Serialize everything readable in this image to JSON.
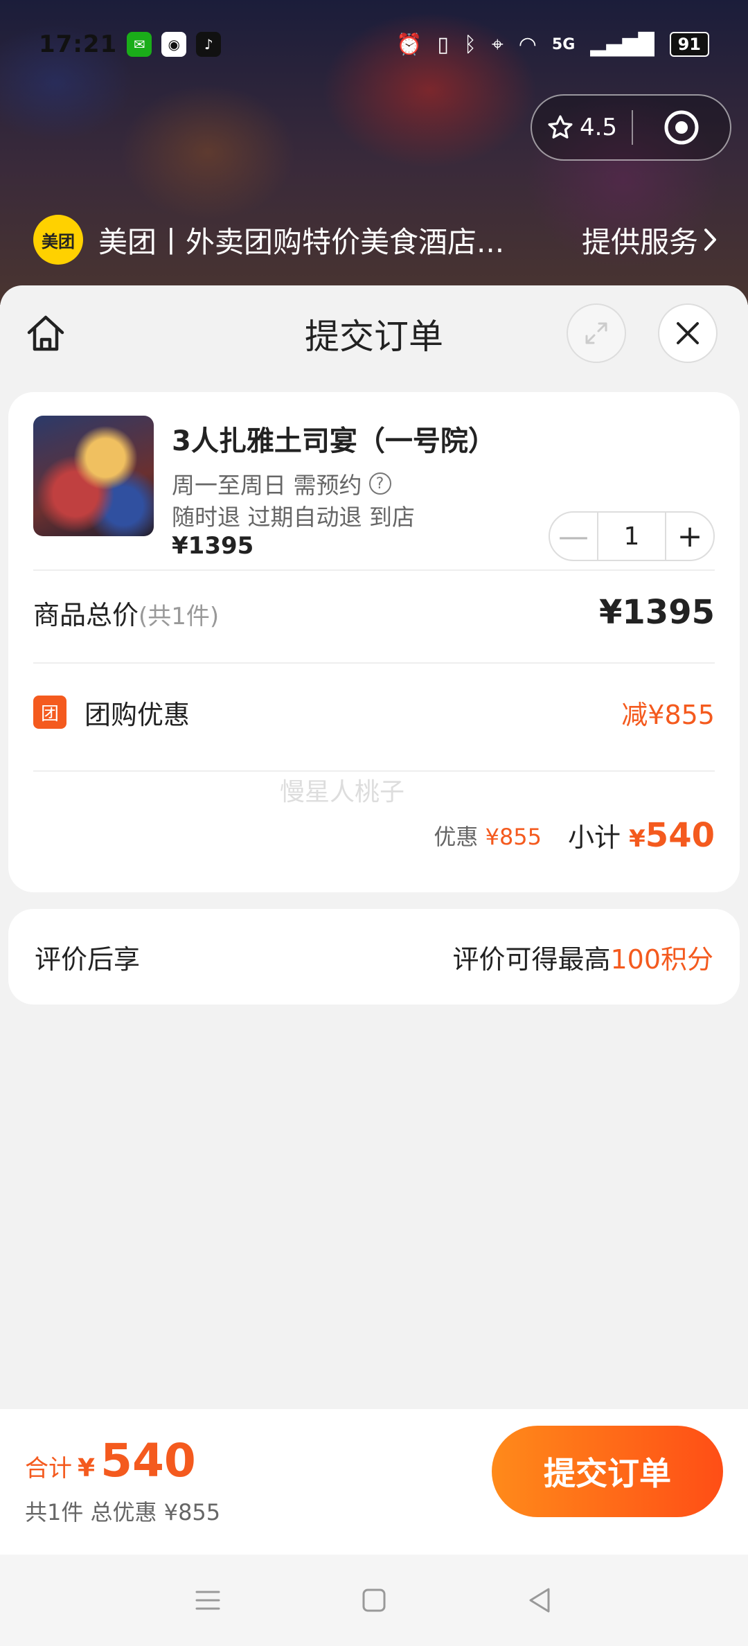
{
  "status_bar": {
    "time": "17:21",
    "network": "5G",
    "battery": "91"
  },
  "mini_program": {
    "rating": "4.5",
    "app_logo_text": "美团",
    "app_name": "美团丨外卖团购特价美食酒店...",
    "service_link": "提供服务"
  },
  "sheet": {
    "title": "提交订单"
  },
  "product": {
    "name": "3人扎雅土司宴（一号院）",
    "availability": "周一至周日 需预约",
    "policy": "随时退 过期自动退 到店",
    "price": "¥1395",
    "quantity": "1"
  },
  "summary": {
    "total_label": "商品总价",
    "total_count": "(共1件)",
    "total_value": "¥1395",
    "discount_badge": "团",
    "discount_label": "团购优惠",
    "discount_value": "减¥855",
    "watermark": "慢星人桃子",
    "saving_label": "优惠",
    "saving_value": "¥855",
    "subtotal_label": "小计",
    "subtotal_yen": "¥",
    "subtotal_value": "540"
  },
  "review": {
    "label": "评价后享",
    "desc": "评价可得最高",
    "points": "100积分"
  },
  "bottom": {
    "sum_label": "合计",
    "sum_yen": "¥",
    "sum_value": "540",
    "sum_sub": "共1件 总优惠 ¥855",
    "submit_label": "提交订单"
  },
  "colors": {
    "accent": "#f45a1e",
    "brand_yellow": "#ffd100"
  }
}
